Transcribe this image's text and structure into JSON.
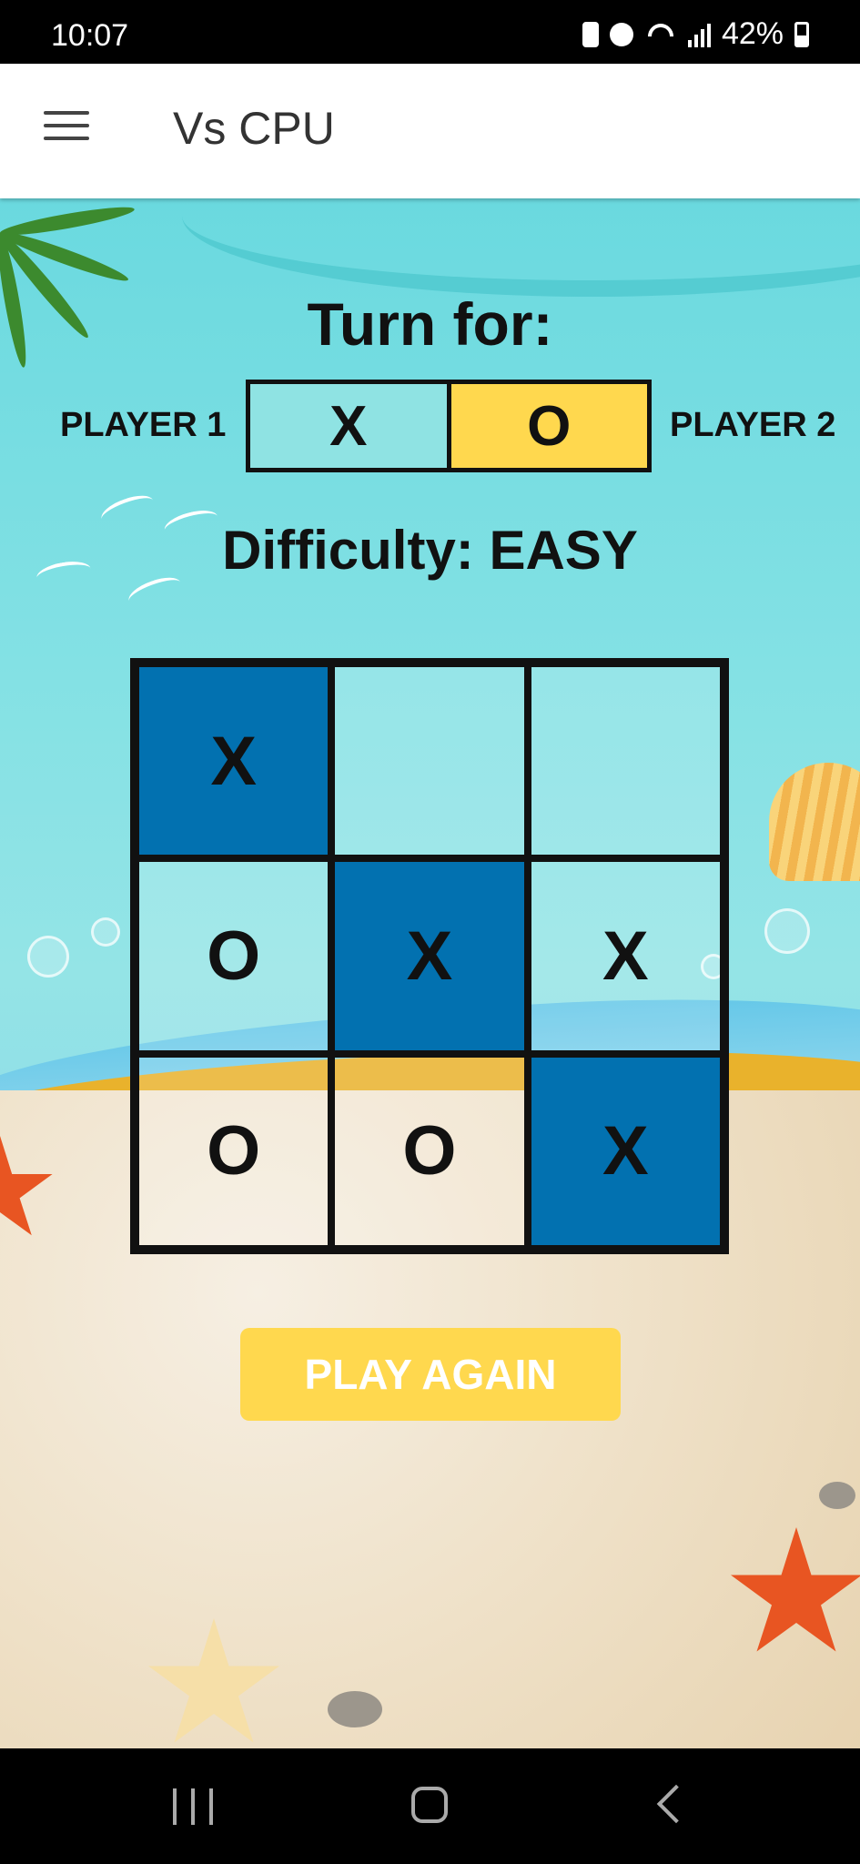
{
  "status_bar": {
    "time": "10:07",
    "battery": "42%",
    "icons": [
      "battery-saver-icon",
      "alarm-icon",
      "wifi-icon",
      "signal-icon",
      "battery-icon"
    ]
  },
  "app_bar": {
    "title": "Vs CPU",
    "menu_icon": "hamburger-menu-icon"
  },
  "game": {
    "turn_label": "Turn for:",
    "player1_label": "PLAYER 1",
    "player2_label": "PLAYER 2",
    "player1_symbol": "X",
    "player2_symbol": "O",
    "active_player": "PLAYER 2",
    "difficulty": "Difficulty: EASY",
    "board": [
      [
        "X",
        "",
        ""
      ],
      [
        "O",
        "X",
        "X"
      ],
      [
        "O",
        "O",
        "X"
      ]
    ],
    "winning_line": "diagonal",
    "play_again_label": "PLAY AGAIN"
  },
  "colors": {
    "win_cell": "#0271b0",
    "x_turn": "#8fe3e3",
    "o_turn": "#ffd84e",
    "button": "#ffd84e"
  },
  "nav_bar": {
    "icons": [
      "recent-apps-icon",
      "home-icon",
      "back-icon"
    ]
  }
}
